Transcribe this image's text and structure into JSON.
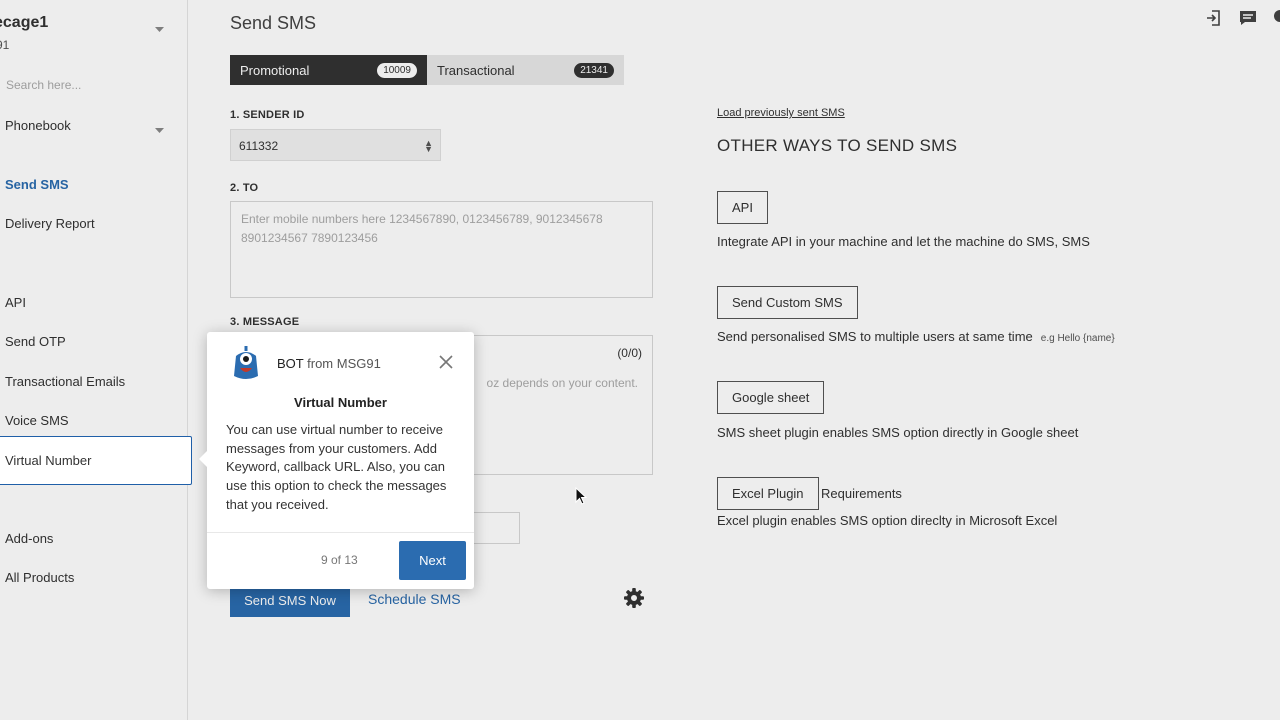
{
  "sidebar": {
    "brand": "ecage1",
    "brand_sub": "91",
    "search_placeholder": "Search here...",
    "items": [
      {
        "label": "Phonebook"
      },
      {
        "label": "Send SMS"
      },
      {
        "label": "Delivery Report"
      },
      {
        "label": "API"
      },
      {
        "label": "Send OTP"
      },
      {
        "label": "Transactional Emails"
      },
      {
        "label": "Voice SMS"
      },
      {
        "label": "Virtual Number"
      },
      {
        "label": "Add-ons"
      },
      {
        "label": "All Products"
      }
    ]
  },
  "header": {
    "title": "Send SMS"
  },
  "tabs": [
    {
      "label": "Promotional",
      "count": "10009"
    },
    {
      "label": "Transactional",
      "count": "21341"
    }
  ],
  "form": {
    "sender_label": "1. SENDER ID",
    "sender_value": "611332",
    "to_label": "2. TO",
    "to_placeholder": "Enter mobile numbers here 1234567890, 0123456789, 9012345678 8901234567 7890123456",
    "message_label": "3. MESSAGE",
    "message_count": "(0/0)",
    "message_hint": "oz depends on your content.",
    "send_now": "Send SMS Now",
    "schedule": "Schedule SMS"
  },
  "right": {
    "load_link": "Load previously sent SMS",
    "title": "OTHER WAYS TO SEND SMS",
    "options": [
      {
        "button": "API",
        "desc": "Integrate API in your machine and let the machine do SMS, SMS",
        "example": ""
      },
      {
        "button": "Send Custom SMS",
        "desc": "Send personalised SMS to multiple users at same time",
        "example": "e.g Hello {name}"
      },
      {
        "button": "Google sheet",
        "desc": "SMS sheet plugin enables SMS option directly in Google sheet",
        "example": ""
      },
      {
        "button": "Excel Plugin",
        "desc": "Excel plugin enables SMS option direclty in Microsoft Excel",
        "example": ""
      }
    ],
    "requirements": "Requirements"
  },
  "popup": {
    "bot": "BOT",
    "from": "from MSG91",
    "title": "Virtual Number",
    "body": "You can use virtual number to receive messages from your customers. Add Keyword, callback URL. Also, you can use this option to check the messages that you received.",
    "step": "9 of 13",
    "next": "Next"
  },
  "colors": {
    "accent": "#2b6cb0",
    "dark_tab": "#333333"
  }
}
